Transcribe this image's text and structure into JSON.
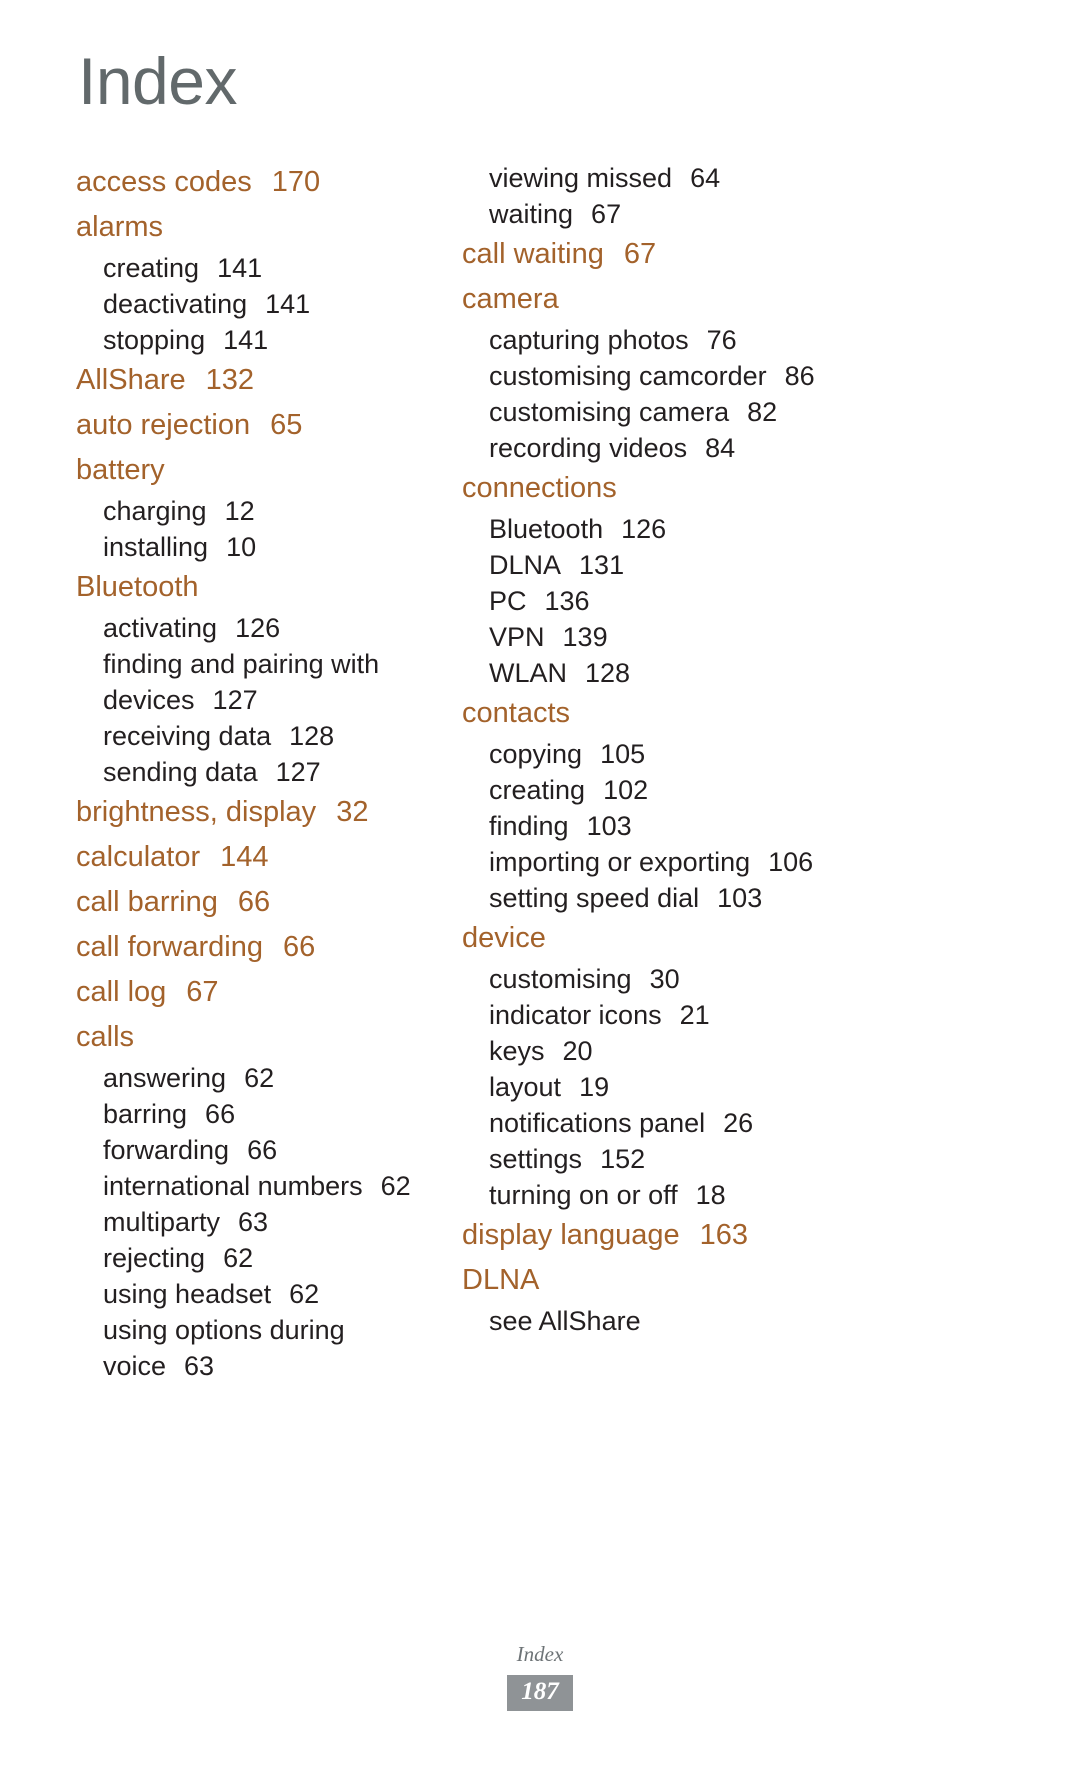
{
  "title": "Index",
  "colors": {
    "heading": "#62696b",
    "entry_accent": "#a3622b",
    "sub_entry": "#231f20",
    "footer_badge": "#8f9396"
  },
  "columns": {
    "left": [
      {
        "type": "main",
        "label": "access codes",
        "page": "170"
      },
      {
        "type": "main",
        "label": "alarms",
        "page": ""
      },
      {
        "type": "sub",
        "label": "creating",
        "page": "141"
      },
      {
        "type": "sub",
        "label": "deactivating",
        "page": "141"
      },
      {
        "type": "sub",
        "label": "stopping",
        "page": "141"
      },
      {
        "type": "main",
        "label": "AllShare",
        "page": "132"
      },
      {
        "type": "main",
        "label": "auto rejection",
        "page": "65"
      },
      {
        "type": "main",
        "label": "battery",
        "page": ""
      },
      {
        "type": "sub",
        "label": "charging",
        "page": "12"
      },
      {
        "type": "sub",
        "label": "installing",
        "page": "10"
      },
      {
        "type": "main",
        "label": "Bluetooth",
        "page": ""
      },
      {
        "type": "sub",
        "label": "activating",
        "page": "126"
      },
      {
        "type": "sub",
        "label": "finding and pairing with",
        "label2": "devices",
        "page": "127"
      },
      {
        "type": "sub",
        "label": "receiving data",
        "page": "128"
      },
      {
        "type": "sub",
        "label": "sending data",
        "page": "127"
      },
      {
        "type": "main",
        "label": "brightness, display",
        "page": "32"
      },
      {
        "type": "main",
        "label": "calculator",
        "page": "144"
      },
      {
        "type": "main",
        "label": "call barring",
        "page": "66"
      },
      {
        "type": "main",
        "label": "call forwarding",
        "page": "66"
      },
      {
        "type": "main",
        "label": "call log",
        "page": "67"
      },
      {
        "type": "main",
        "label": "calls",
        "page": ""
      },
      {
        "type": "sub",
        "label": "answering",
        "page": "62"
      },
      {
        "type": "sub",
        "label": "barring",
        "page": "66"
      },
      {
        "type": "sub",
        "label": "forwarding",
        "page": "66"
      },
      {
        "type": "sub",
        "label": "international numbers",
        "page": "62"
      },
      {
        "type": "sub",
        "label": "multiparty",
        "page": "63"
      },
      {
        "type": "sub",
        "label": "rejecting",
        "page": "62"
      },
      {
        "type": "sub",
        "label": "using headset",
        "page": "62"
      },
      {
        "type": "sub",
        "label": "using options during",
        "label2": "voice",
        "page": "63"
      }
    ],
    "right": [
      {
        "type": "sub",
        "label": "viewing missed",
        "page": "64"
      },
      {
        "type": "sub",
        "label": "waiting",
        "page": "67"
      },
      {
        "type": "main",
        "label": "call waiting",
        "page": "67"
      },
      {
        "type": "main",
        "label": "camera",
        "page": ""
      },
      {
        "type": "sub",
        "label": "capturing photos",
        "page": "76"
      },
      {
        "type": "sub",
        "label": "customising camcorder",
        "page": "86"
      },
      {
        "type": "sub",
        "label": "customising camera",
        "page": "82"
      },
      {
        "type": "sub",
        "label": "recording videos",
        "page": "84"
      },
      {
        "type": "main",
        "label": "connections",
        "page": ""
      },
      {
        "type": "sub",
        "label": "Bluetooth",
        "page": "126"
      },
      {
        "type": "sub",
        "label": "DLNA",
        "page": "131"
      },
      {
        "type": "sub",
        "label": "PC",
        "page": "136"
      },
      {
        "type": "sub",
        "label": "VPN",
        "page": "139"
      },
      {
        "type": "sub",
        "label": "WLAN",
        "page": "128"
      },
      {
        "type": "main",
        "label": "contacts",
        "page": ""
      },
      {
        "type": "sub",
        "label": "copying",
        "page": "105"
      },
      {
        "type": "sub",
        "label": "creating",
        "page": "102"
      },
      {
        "type": "sub",
        "label": "finding",
        "page": "103"
      },
      {
        "type": "sub",
        "label": "importing or exporting",
        "page": "106"
      },
      {
        "type": "sub",
        "label": "setting speed dial",
        "page": "103"
      },
      {
        "type": "main",
        "label": "device",
        "page": ""
      },
      {
        "type": "sub",
        "label": "customising",
        "page": "30"
      },
      {
        "type": "sub",
        "label": "indicator icons",
        "page": "21"
      },
      {
        "type": "sub",
        "label": "keys",
        "page": "20"
      },
      {
        "type": "sub",
        "label": "layout",
        "page": "19"
      },
      {
        "type": "sub",
        "label": "notifications panel",
        "page": "26"
      },
      {
        "type": "sub",
        "label": "settings",
        "page": "152"
      },
      {
        "type": "sub",
        "label": "turning on or off",
        "page": "18"
      },
      {
        "type": "main",
        "label": "display language",
        "page": "163"
      },
      {
        "type": "main",
        "label": "DLNA",
        "page": ""
      },
      {
        "type": "sub",
        "label": "see AllShare",
        "page": ""
      }
    ]
  },
  "footer": {
    "label": "Index",
    "page_number": "187"
  }
}
